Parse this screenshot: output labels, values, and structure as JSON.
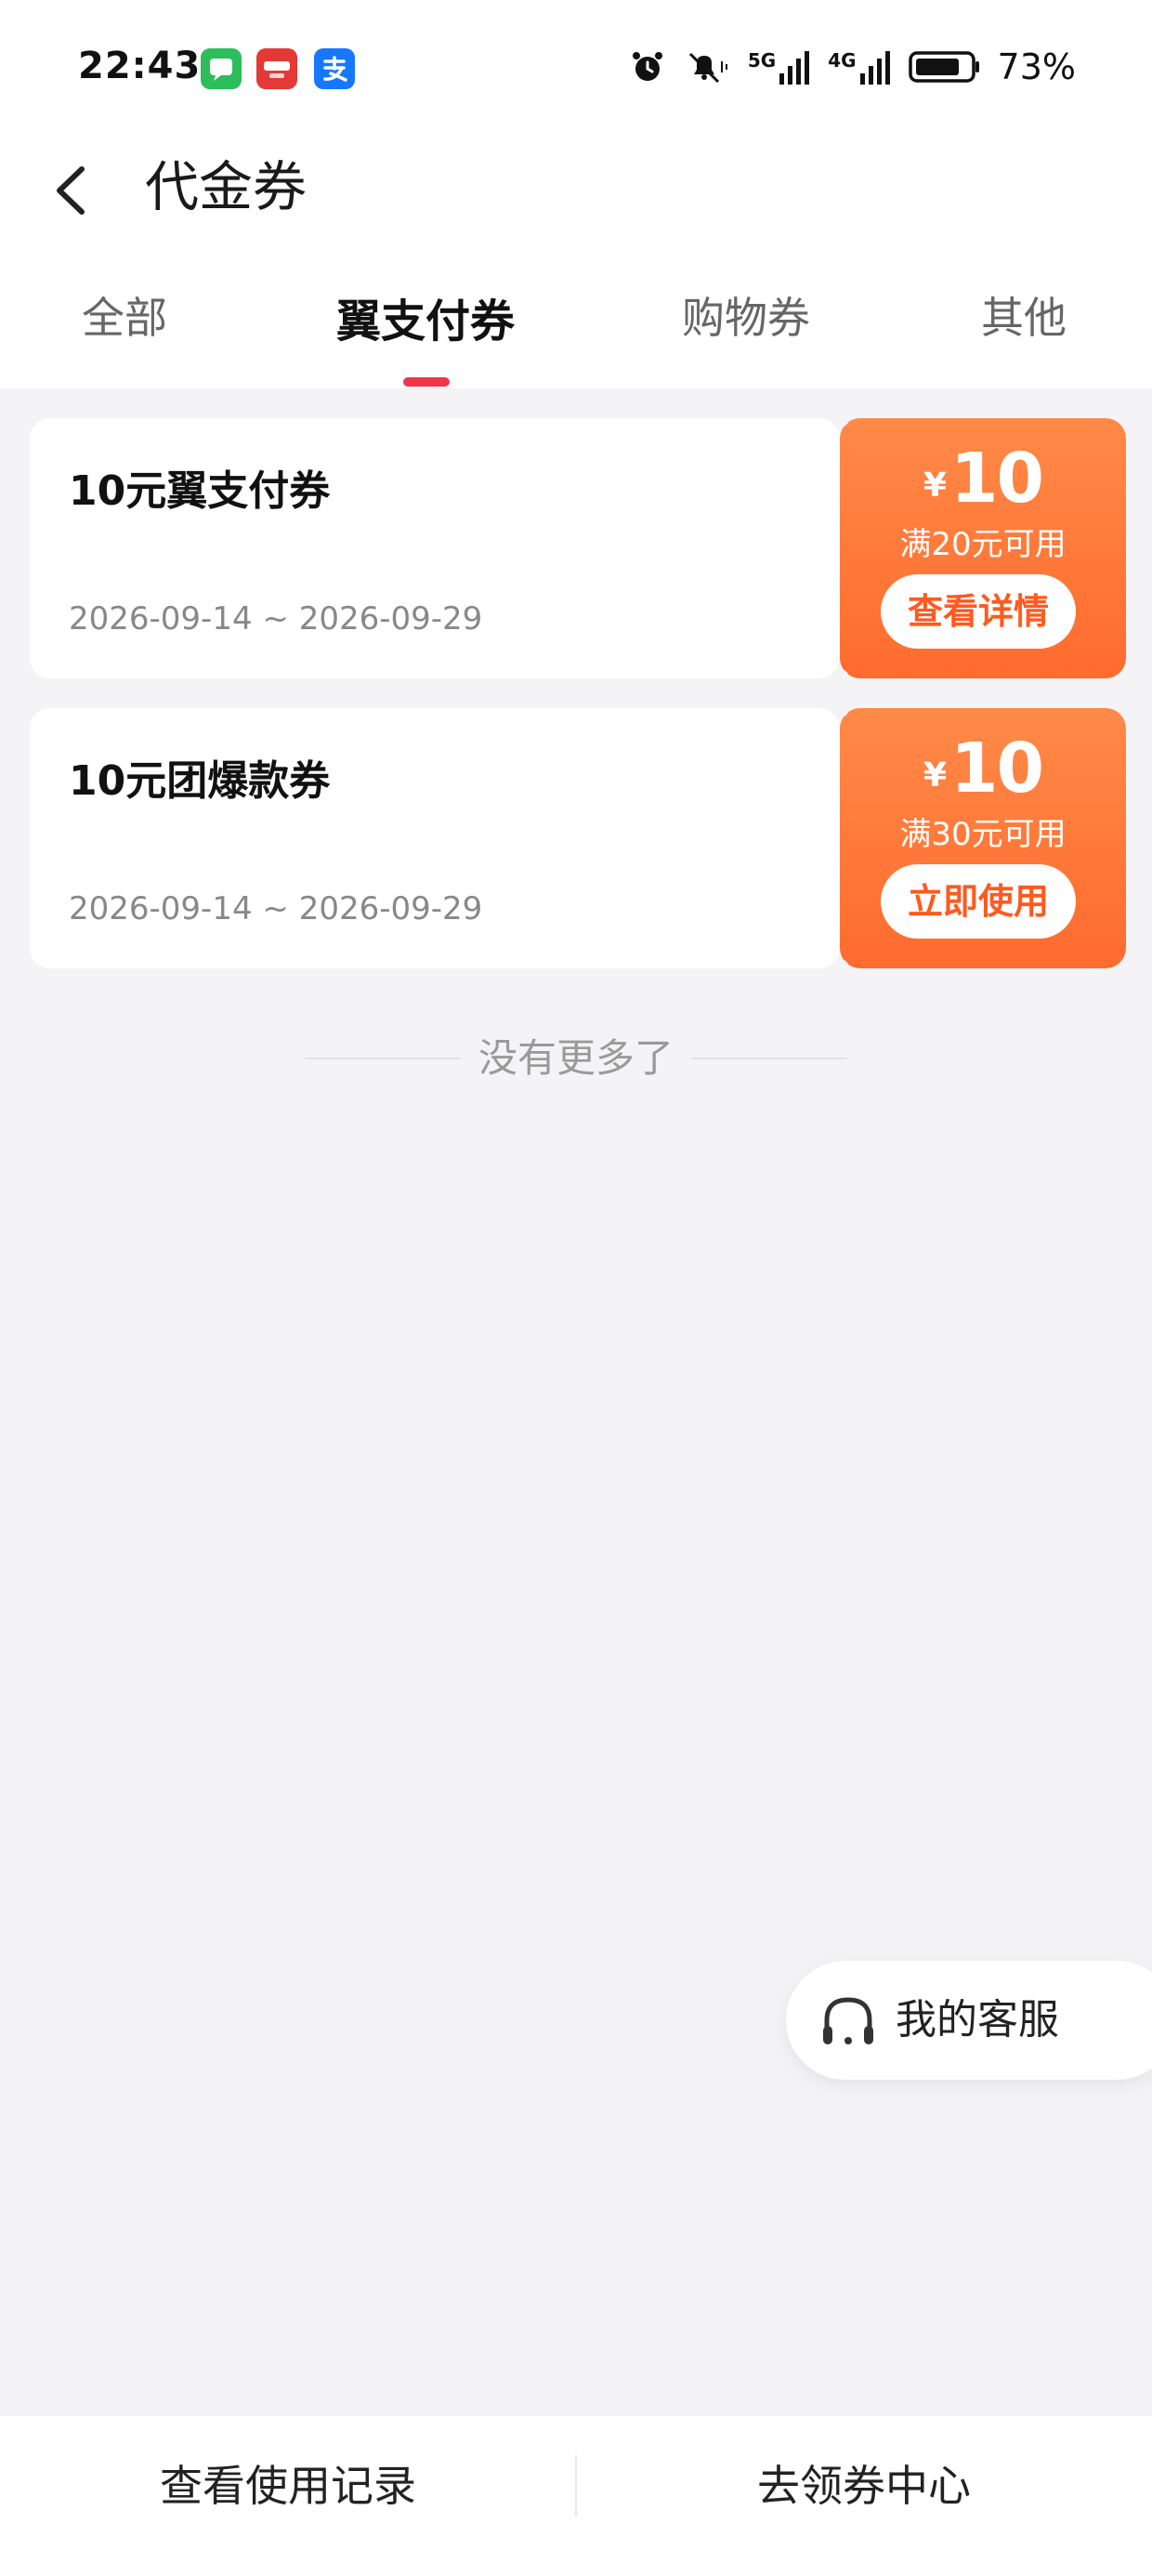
{
  "status_bar": {
    "time": "22:43",
    "network_5g": "5G",
    "network_4g": "4G",
    "battery": "73%"
  },
  "header": {
    "title": "代金券"
  },
  "tabs": [
    {
      "label": "全部",
      "active": false
    },
    {
      "label": "翼支付券",
      "active": true
    },
    {
      "label": "购物券",
      "active": false
    },
    {
      "label": "其他",
      "active": false
    }
  ],
  "coupons": [
    {
      "name": "10元翼支付券",
      "date": "2026-09-14 ~ 2026-09-29",
      "currency": "¥",
      "amount": "10",
      "condition": "满20元可用",
      "button": "查看详情"
    },
    {
      "name": "10元团爆款券",
      "date": "2026-09-14 ~ 2026-09-29",
      "currency": "¥",
      "amount": "10",
      "condition": "满30元可用",
      "button": "立即使用"
    }
  ],
  "list_end_text": "没有更多了",
  "service": {
    "label": "我的客服"
  },
  "bottom_bar": {
    "left_label": "查看使用记录",
    "right_label": "去领券中心"
  },
  "colors": {
    "accent_red": "#f0344a",
    "coupon_orange": "#ff6b2e",
    "background": "#f4f4f6"
  }
}
